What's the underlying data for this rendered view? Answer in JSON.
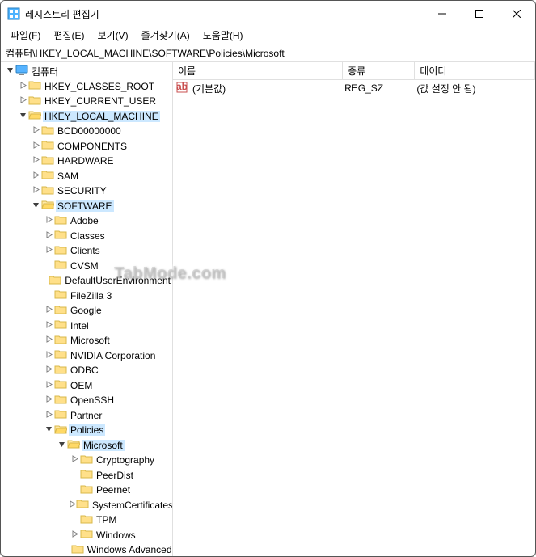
{
  "title": "레지스트리 편집기",
  "menu": {
    "file": "파일(F)",
    "edit": "편집(E)",
    "view": "보기(V)",
    "fav": "즐겨찾기(A)",
    "help": "도움말(H)"
  },
  "address": "컴퓨터\\HKEY_LOCAL_MACHINE\\SOFTWARE\\Policies\\Microsoft",
  "columns": {
    "name": "이름",
    "type": "종류",
    "data": "데이터"
  },
  "colwidths": {
    "name": 212,
    "type": 90,
    "data": 150
  },
  "values": [
    {
      "name": "(기본값)",
      "type": "REG_SZ",
      "data": "(값 설정 안 됨)"
    }
  ],
  "watermark": "TabMode.com",
  "tree": [
    {
      "d": 0,
      "label": "컴퓨터",
      "exp": "open",
      "icon": "pc",
      "sel": false
    },
    {
      "d": 1,
      "label": "HKEY_CLASSES_ROOT",
      "exp": "closed"
    },
    {
      "d": 1,
      "label": "HKEY_CURRENT_USER",
      "exp": "closed"
    },
    {
      "d": 1,
      "label": "HKEY_LOCAL_MACHINE",
      "exp": "open",
      "sel": true
    },
    {
      "d": 2,
      "label": "BCD00000000",
      "exp": "closed"
    },
    {
      "d": 2,
      "label": "COMPONENTS",
      "exp": "closed"
    },
    {
      "d": 2,
      "label": "HARDWARE",
      "exp": "closed"
    },
    {
      "d": 2,
      "label": "SAM",
      "exp": "closed"
    },
    {
      "d": 2,
      "label": "SECURITY",
      "exp": "closed"
    },
    {
      "d": 2,
      "label": "SOFTWARE",
      "exp": "open",
      "sel": true
    },
    {
      "d": 3,
      "label": "Adobe",
      "exp": "closed"
    },
    {
      "d": 3,
      "label": "Classes",
      "exp": "closed"
    },
    {
      "d": 3,
      "label": "Clients",
      "exp": "closed"
    },
    {
      "d": 3,
      "label": "CVSM",
      "exp": "none"
    },
    {
      "d": 3,
      "label": "DefaultUserEnvironment",
      "exp": "none"
    },
    {
      "d": 3,
      "label": "FileZilla 3",
      "exp": "none"
    },
    {
      "d": 3,
      "label": "Google",
      "exp": "closed"
    },
    {
      "d": 3,
      "label": "Intel",
      "exp": "closed"
    },
    {
      "d": 3,
      "label": "Microsoft",
      "exp": "closed"
    },
    {
      "d": 3,
      "label": "NVIDIA Corporation",
      "exp": "closed"
    },
    {
      "d": 3,
      "label": "ODBC",
      "exp": "closed"
    },
    {
      "d": 3,
      "label": "OEM",
      "exp": "closed"
    },
    {
      "d": 3,
      "label": "OpenSSH",
      "exp": "closed"
    },
    {
      "d": 3,
      "label": "Partner",
      "exp": "closed"
    },
    {
      "d": 3,
      "label": "Policies",
      "exp": "open",
      "sel": true
    },
    {
      "d": 4,
      "label": "Microsoft",
      "exp": "open",
      "sel": true
    },
    {
      "d": 5,
      "label": "Cryptography",
      "exp": "closed"
    },
    {
      "d": 5,
      "label": "PeerDist",
      "exp": "none"
    },
    {
      "d": 5,
      "label": "Peernet",
      "exp": "none"
    },
    {
      "d": 5,
      "label": "SystemCertificates",
      "exp": "closed"
    },
    {
      "d": 5,
      "label": "TPM",
      "exp": "none"
    },
    {
      "d": 5,
      "label": "Windows",
      "exp": "closed"
    },
    {
      "d": 5,
      "label": "Windows Advanced",
      "exp": "none"
    }
  ]
}
